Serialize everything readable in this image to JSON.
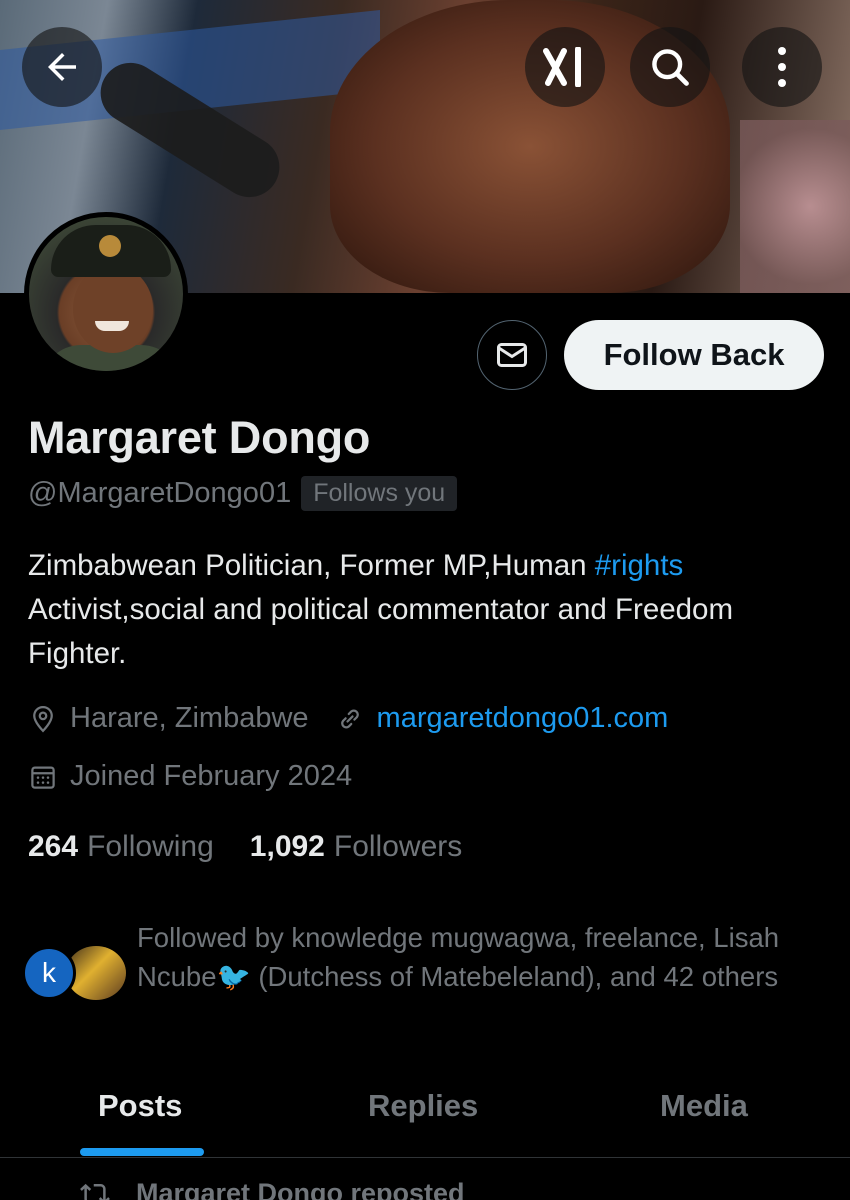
{
  "profile": {
    "name": "Margaret Dongo",
    "handle": "@MargaretDongo01",
    "follows_you": "Follows you",
    "bio_main": "Zimbabwean Politician, Former MP,Human ",
    "bio_hashtag": "#rights",
    "bio_rest": "Activist,social and political commentator and Freedom Fighter.",
    "location": "Harare, Zimbabwe",
    "website": "margaretdongo01.com",
    "joined": "Joined February 2024",
    "following_count": "264",
    "following_label": "Following",
    "followers_count": "1,092",
    "followers_label": "Followers"
  },
  "actions": {
    "follow_back_label": "Follow Back"
  },
  "mutuals": {
    "avatar_letter": "k",
    "text": "Followed by knowledge mugwagwa, freelance, Lisah Ncube🐦 (Dutchess of Matebeleland), and 42 others"
  },
  "tabs": [
    {
      "label": "Posts",
      "active": true
    },
    {
      "label": "Replies",
      "active": false
    },
    {
      "label": "Media",
      "active": false
    }
  ],
  "feed": {
    "first_item_context": "Margaret Dongo reposted"
  },
  "icons": {
    "back": "arrow-left-icon",
    "grok": "grok-icon",
    "search": "search-icon",
    "more": "more-vertical-icon",
    "message": "envelope-icon",
    "location": "location-pin-icon",
    "link": "link-icon",
    "calendar": "calendar-icon",
    "repost": "repost-icon"
  },
  "colors": {
    "background": "#000000",
    "text_primary": "#e7e9ea",
    "text_secondary": "#71767b",
    "accent": "#1d9bf0",
    "follow_button_bg": "#eff3f4"
  }
}
